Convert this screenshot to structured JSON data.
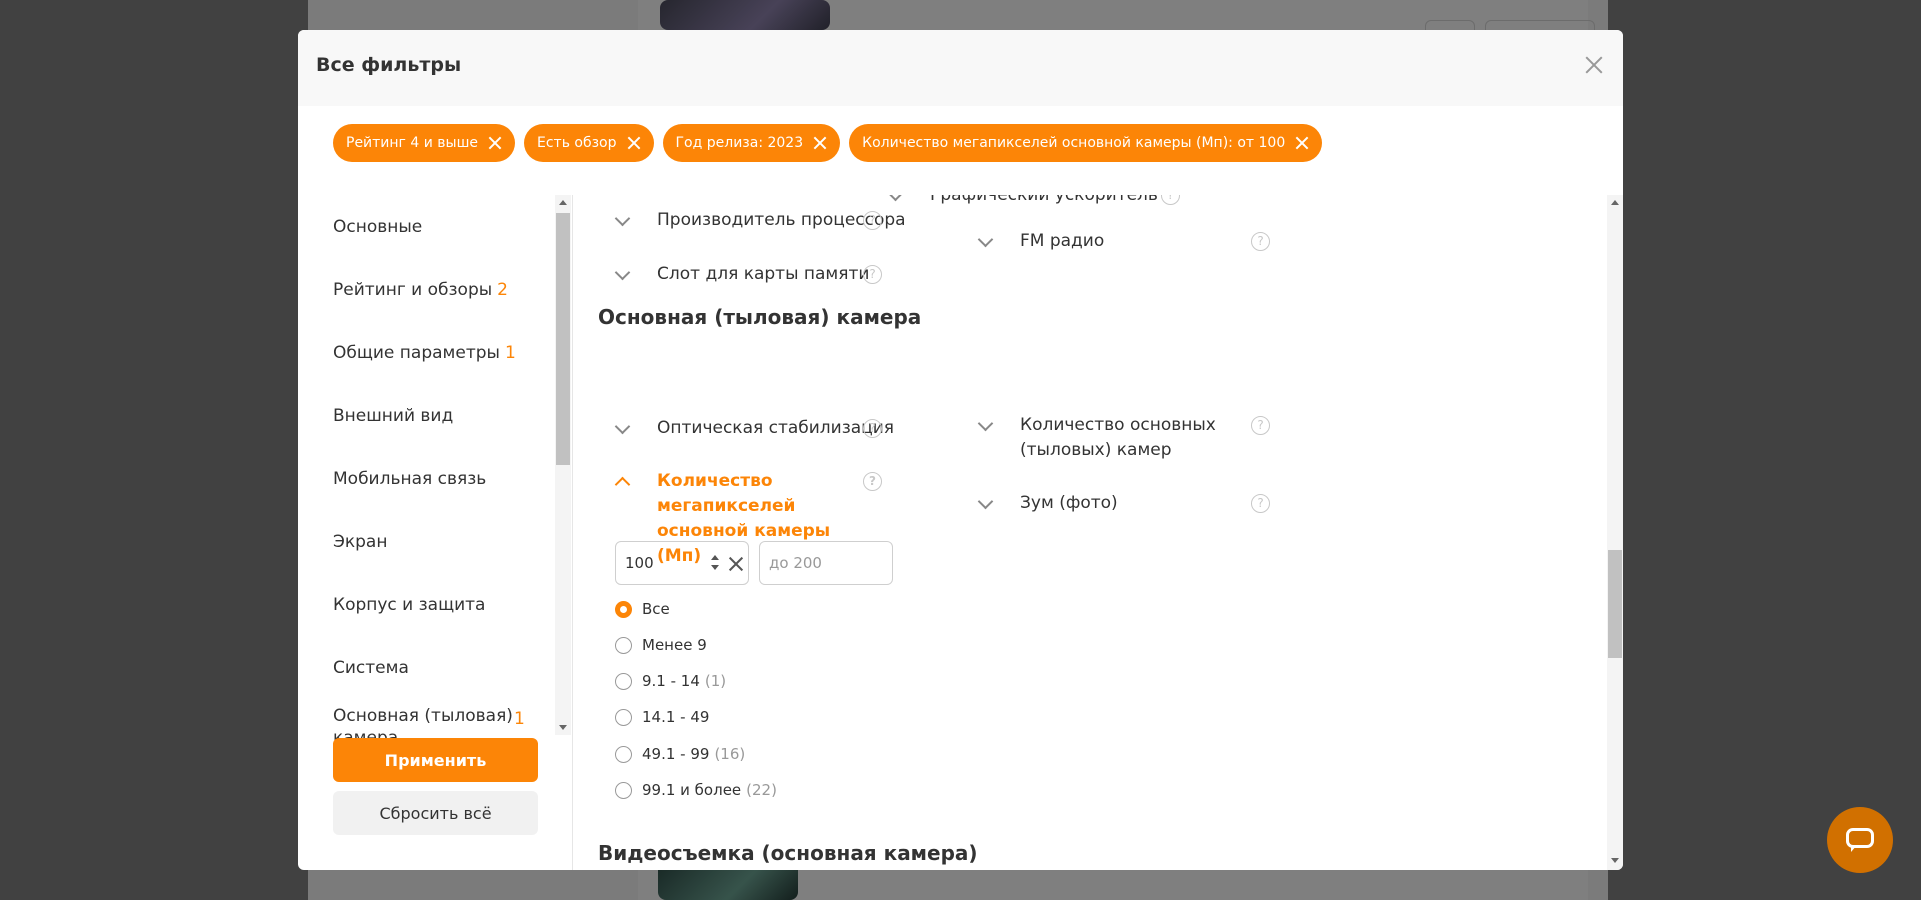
{
  "modal": {
    "title": "Все фильтры"
  },
  "chips": [
    {
      "label": "Рейтинг 4 и выше"
    },
    {
      "label": "Есть обзор"
    },
    {
      "label": "Год релиза: 2023"
    },
    {
      "label": "Количество мегапикселей основной камеры (Мп): от 100"
    }
  ],
  "sidebar": {
    "items": [
      {
        "label": "Основные",
        "badge": ""
      },
      {
        "label": "Рейтинг и обзоры",
        "badge": "2"
      },
      {
        "label": "Общие параметры",
        "badge": "1"
      },
      {
        "label": "Внешний вид",
        "badge": ""
      },
      {
        "label": "Мобильная связь",
        "badge": ""
      },
      {
        "label": "Экран",
        "badge": ""
      },
      {
        "label": "Корпус и защита",
        "badge": ""
      },
      {
        "label": "Система",
        "badge": ""
      },
      {
        "label": "Основная (тыловая) камера",
        "badge": "1"
      }
    ],
    "apply_label": "Применить",
    "reset_label": "Сбросить всё"
  },
  "content": {
    "prev_section": {
      "left": [
        {
          "label": "Производитель процессора"
        },
        {
          "label": "Слот для карты памяти"
        }
      ],
      "right": [
        {
          "label": "Графический ускоритель"
        },
        {
          "label": "FM радио"
        }
      ]
    },
    "camera_section": {
      "title": "Основная (тыловая) камера",
      "left": [
        {
          "label": "Оптическая стабилизация"
        },
        {
          "label": "Количество мегапикселей основной камеры (Мп)",
          "expanded": true
        }
      ],
      "right": [
        {
          "label": "Количество основных (тыловых) камер"
        },
        {
          "label": "Зум (фото)"
        }
      ],
      "range": {
        "from_value": "100",
        "to_placeholder": "до 200"
      },
      "options": [
        {
          "label": "Все",
          "count": "",
          "checked": true
        },
        {
          "label": "Менее 9",
          "count": ""
        },
        {
          "label": "9.1 - 14",
          "count": "(1)"
        },
        {
          "label": "14.1 - 49",
          "count": ""
        },
        {
          "label": "49.1 - 99",
          "count": "(16)"
        },
        {
          "label": "99.1 и более",
          "count": "(22)"
        }
      ]
    },
    "next_section_title": "Видеосъемка (основная камера)"
  },
  "help_glyph": "?",
  "colors": {
    "accent": "#fc8507",
    "chat": "#d17000"
  }
}
